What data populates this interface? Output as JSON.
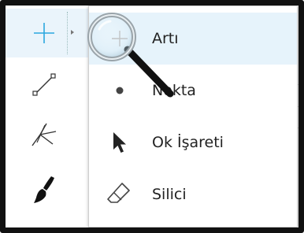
{
  "toolbar": {
    "tools": [
      {
        "name": "plus-tool",
        "icon": "crosshair-plus-icon",
        "active": true
      },
      {
        "name": "line-tool",
        "icon": "line-segment-icon",
        "active": false
      },
      {
        "name": "fork-tool",
        "icon": "fork-lines-icon",
        "active": false
      },
      {
        "name": "brush-tool",
        "icon": "paintbrush-icon",
        "active": false
      }
    ]
  },
  "menu": {
    "items": [
      {
        "label": "Artı",
        "icon": "plus-icon",
        "hovered": true
      },
      {
        "label": "Nokta",
        "icon": "dot-icon",
        "hovered": false
      },
      {
        "label": "Ok İşareti",
        "icon": "arrow-cursor-icon",
        "hovered": false
      },
      {
        "label": "Silici",
        "icon": "eraser-icon",
        "hovered": false
      }
    ]
  },
  "colors": {
    "accent_blue": "#2aa7df",
    "hover_bg": "#e6f3fb",
    "frame": "#111111"
  }
}
